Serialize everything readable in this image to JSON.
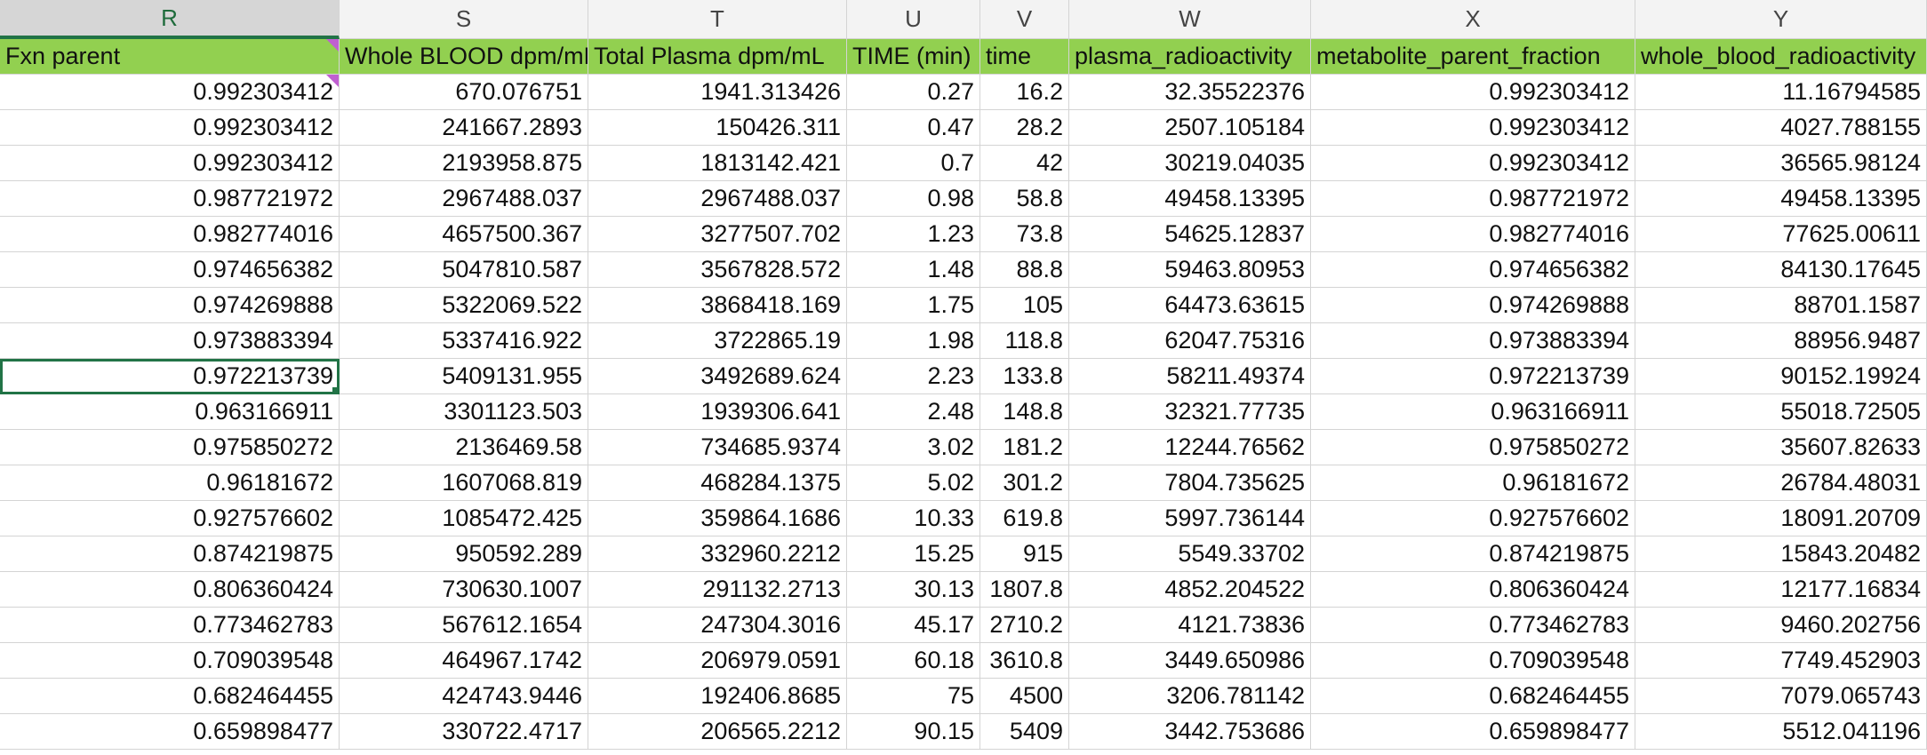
{
  "columns": [
    "R",
    "S",
    "T",
    "U",
    "V",
    "W",
    "X",
    "Y"
  ],
  "selected_column": "R",
  "header_row": [
    "Fxn parent",
    "Whole BLOOD dpm/mL",
    "Total Plasma dpm/mL",
    "TIME (min)",
    "time",
    "plasma_radioactivity",
    "metabolite_parent_fraction",
    "whole_blood_radioactivity"
  ],
  "rows": [
    [
      "0.992303412",
      "670.076751",
      "1941.313426",
      "0.27",
      "16.2",
      "32.35522376",
      "0.992303412",
      "11.16794585"
    ],
    [
      "0.992303412",
      "241667.2893",
      "150426.311",
      "0.47",
      "28.2",
      "2507.105184",
      "0.992303412",
      "4027.788155"
    ],
    [
      "0.992303412",
      "2193958.875",
      "1813142.421",
      "0.7",
      "42",
      "30219.04035",
      "0.992303412",
      "36565.98124"
    ],
    [
      "0.987721972",
      "2967488.037",
      "2967488.037",
      "0.98",
      "58.8",
      "49458.13395",
      "0.987721972",
      "49458.13395"
    ],
    [
      "0.982774016",
      "4657500.367",
      "3277507.702",
      "1.23",
      "73.8",
      "54625.12837",
      "0.982774016",
      "77625.00611"
    ],
    [
      "0.974656382",
      "5047810.587",
      "3567828.572",
      "1.48",
      "88.8",
      "59463.80953",
      "0.974656382",
      "84130.17645"
    ],
    [
      "0.974269888",
      "5322069.522",
      "3868418.169",
      "1.75",
      "105",
      "64473.63615",
      "0.974269888",
      "88701.1587"
    ],
    [
      "0.973883394",
      "5337416.922",
      "3722865.19",
      "1.98",
      "118.8",
      "62047.75316",
      "0.973883394",
      "88956.9487"
    ],
    [
      "0.972213739",
      "5409131.955",
      "3492689.624",
      "2.23",
      "133.8",
      "58211.49374",
      "0.972213739",
      "90152.19924"
    ],
    [
      "0.963166911",
      "3301123.503",
      "1939306.641",
      "2.48",
      "148.8",
      "32321.77735",
      "0.963166911",
      "55018.72505"
    ],
    [
      "0.975850272",
      "2136469.58",
      "734685.9374",
      "3.02",
      "181.2",
      "12244.76562",
      "0.975850272",
      "35607.82633"
    ],
    [
      "0.96181672",
      "1607068.819",
      "468284.1375",
      "5.02",
      "301.2",
      "7804.735625",
      "0.96181672",
      "26784.48031"
    ],
    [
      "0.927576602",
      "1085472.425",
      "359864.1686",
      "10.33",
      "619.8",
      "5997.736144",
      "0.927576602",
      "18091.20709"
    ],
    [
      "0.874219875",
      "950592.289",
      "332960.2212",
      "15.25",
      "915",
      "5549.33702",
      "0.874219875",
      "15843.20482"
    ],
    [
      "0.806360424",
      "730630.1007",
      "291132.2713",
      "30.13",
      "1807.8",
      "4852.204522",
      "0.806360424",
      "12177.16834"
    ],
    [
      "0.773462783",
      "567612.1654",
      "247304.3016",
      "45.17",
      "2710.2",
      "4121.73836",
      "0.773462783",
      "9460.202756"
    ],
    [
      "0.709039548",
      "464967.1742",
      "206979.0591",
      "60.18",
      "3610.8",
      "3449.650986",
      "0.709039548",
      "7749.452903"
    ],
    [
      "0.682464455",
      "424743.9446",
      "192406.8685",
      "75",
      "4500",
      "3206.781142",
      "0.682464455",
      "7079.065743"
    ],
    [
      "0.659898477",
      "330722.4717",
      "206565.2212",
      "90.15",
      "5409",
      "3442.753686",
      "0.659898477",
      "5512.041196"
    ]
  ],
  "active_cell": {
    "row": 9,
    "column": "R"
  },
  "colors": {
    "header_fill": "#92d050",
    "selection": "#217346",
    "comment_marker": "#c05fd1"
  }
}
